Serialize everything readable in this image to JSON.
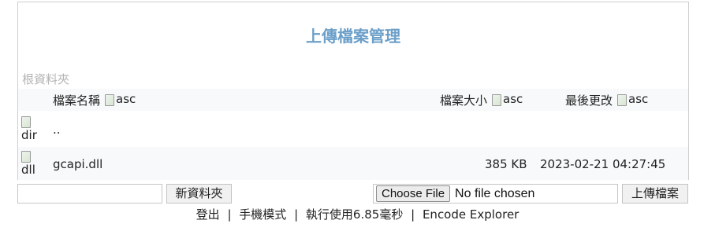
{
  "header": {
    "title": "上傳檔案管理"
  },
  "breadcrumb": {
    "root": "根資料夾"
  },
  "table": {
    "columns": {
      "name": "檔案名稱",
      "size": "檔案大小",
      "modified": "最後更改",
      "sort_alt": "asc"
    },
    "rows": [
      {
        "icon_alt": "dir",
        "name": "..",
        "size": "",
        "modified": ""
      },
      {
        "icon_alt": "dll",
        "name": "gcapi.dll",
        "size": "385 KB",
        "modified": "2023-02-21 04:27:45"
      }
    ]
  },
  "controls": {
    "new_folder_value": "",
    "new_folder_label": "新資料夾",
    "choose_file_label": "Choose File",
    "file_status": "No file chosen",
    "upload_label": "上傳檔案"
  },
  "footer": {
    "logout": "登出",
    "mobile_mode": "手機模式",
    "exec_time": "執行使用6.85毫秒",
    "app_name": "Encode Explorer",
    "separator": "|"
  },
  "colors": {
    "title": "#6b9fc9",
    "breadcrumb": "#b3b3b3",
    "row_alt": "#f7f9fb"
  },
  "icons": {
    "sort": "broken-image-icon",
    "file_type": "broken-image-icon"
  }
}
